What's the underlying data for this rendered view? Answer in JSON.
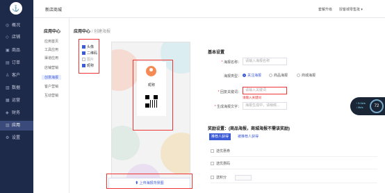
{
  "app": {
    "logo": "⚓",
    "shop_name": "新店商城"
  },
  "topbar": {
    "upgrade": "套餐升级",
    "user": "授客城零售批 ▾"
  },
  "leftnav": [
    {
      "icon": "◎",
      "label": "概况"
    },
    {
      "icon": "◇",
      "label": "店铺"
    },
    {
      "icon": "▣",
      "label": "商品"
    },
    {
      "icon": "▤",
      "label": "订单"
    },
    {
      "icon": "♙",
      "label": "客户"
    },
    {
      "icon": "▥",
      "label": "数据"
    },
    {
      "icon": "▦",
      "label": "运营"
    },
    {
      "icon": "◈",
      "label": "财务"
    },
    {
      "icon": "▧",
      "label": "应用"
    },
    {
      "icon": "⚙",
      "label": "设置"
    }
  ],
  "subnav": {
    "title": "应用中心",
    "items": [
      "应用首页",
      "工具应用",
      "渠道应用",
      "店铺营销",
      "创意海报",
      "客户营销",
      "互动营销"
    ]
  },
  "breadcrumb": {
    "root": "应用中心",
    "sep": "/",
    "current": "创建海报"
  },
  "preview": {
    "checks": [
      {
        "label": "头像",
        "checked": true
      },
      {
        "label": "二维码",
        "checked": true
      },
      {
        "label": "图片",
        "checked": false
      },
      {
        "label": "昵称",
        "checked": true
      }
    ],
    "nickname": "昵称",
    "upload": "⬆ 上传海报背景图"
  },
  "form": {
    "basic_title": "基本设置",
    "name_label": "海报名称：",
    "name_placeholder": "请输入海报名称",
    "type_label": "海报类型：",
    "types": [
      "关注海报",
      "商品海报",
      "商城海报"
    ],
    "keyword_label": "回复关键词：",
    "keyword_placeholder": "请输入关键词",
    "keyword_error": "请输入关键词",
    "gen_label": "生成海报文字：",
    "gen_placeholder": "海报生成中，请稍候...",
    "reward_title": "奖励设置：(商品海报，商城海报不需该奖励)",
    "reward_tabs": [
      "推荐人获得",
      "被推荐人获得"
    ],
    "reward_rows": [
      "送优惠券",
      "送优惠码",
      "送积分"
    ]
  },
  "gauge": {
    "lines": [
      "↑ 3.1k/s",
      "↓ 0k/s"
    ],
    "value": "72"
  }
}
